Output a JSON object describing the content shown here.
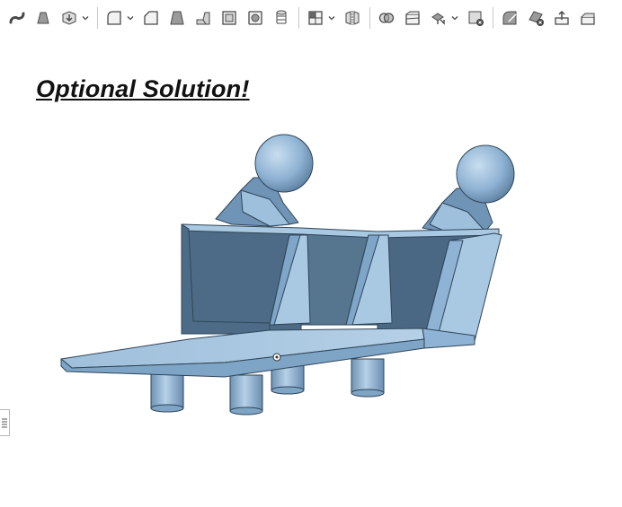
{
  "toolbar": {
    "items": [
      {
        "name": "sweep-icon",
        "kind": "tool"
      },
      {
        "name": "loft-icon",
        "kind": "tool"
      },
      {
        "name": "thicken-icon",
        "kind": "tool",
        "dropdown": true
      },
      {
        "name": "separator"
      },
      {
        "name": "fillet-icon",
        "kind": "tool",
        "dropdown": true
      },
      {
        "name": "chamfer-icon",
        "kind": "tool"
      },
      {
        "name": "draft-icon",
        "kind": "tool"
      },
      {
        "name": "rib-icon",
        "kind": "tool"
      },
      {
        "name": "shell-icon",
        "kind": "tool"
      },
      {
        "name": "hole-icon",
        "kind": "tool"
      },
      {
        "name": "thread-icon",
        "kind": "tool"
      },
      {
        "name": "separator"
      },
      {
        "name": "pattern-icon",
        "kind": "tool",
        "dropdown": true
      },
      {
        "name": "mirror-icon",
        "kind": "tool"
      },
      {
        "name": "separator"
      },
      {
        "name": "boolean-icon",
        "kind": "tool"
      },
      {
        "name": "split-icon",
        "kind": "tool"
      },
      {
        "name": "transform-icon",
        "kind": "tool",
        "dropdown": true
      },
      {
        "name": "delete-part-icon",
        "kind": "tool"
      },
      {
        "name": "separator"
      },
      {
        "name": "modify-fillet-icon",
        "kind": "tool"
      },
      {
        "name": "delete-face-icon",
        "kind": "tool"
      },
      {
        "name": "move-face-icon",
        "kind": "tool"
      },
      {
        "name": "replace-face-icon",
        "kind": "tool"
      }
    ]
  },
  "page": {
    "title": "Optional Solution!"
  },
  "colors": {
    "model_light": "#a9c8e2",
    "model_mid": "#7fa6c8",
    "model_dark": "#4d6b86",
    "model_edge": "#2f4558",
    "icon": "#4a4a4a"
  },
  "viewport": {
    "name": "3d-model-viewport"
  }
}
